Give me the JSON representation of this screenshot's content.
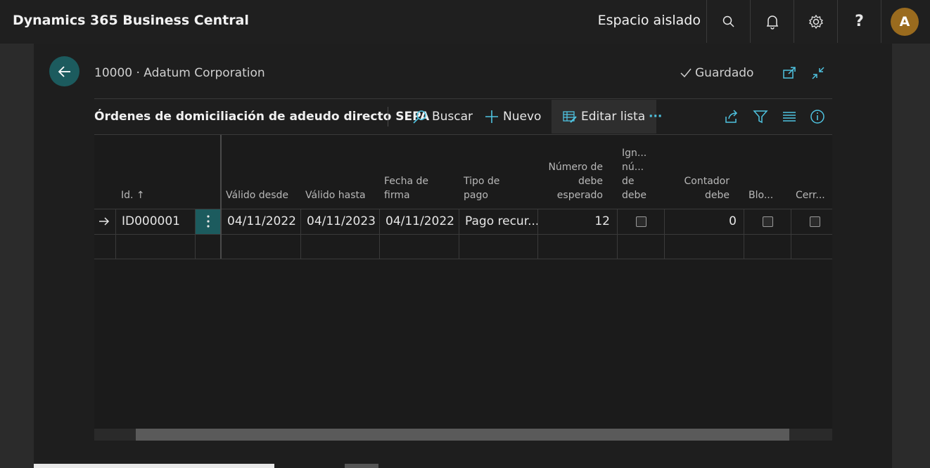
{
  "app": {
    "title": "Dynamics 365 Business Central",
    "environment": "Espacio aislado"
  },
  "topbar": {
    "icons": [
      "search-icon",
      "bell-icon",
      "gear-icon",
      "help-icon"
    ],
    "help_label": "?",
    "avatar_initial": "A"
  },
  "page": {
    "breadcrumb": "10000 · Adatum Corporation",
    "saved_label": "Guardado",
    "title": "Órdenes de domiciliación de adeudo directo SEPA"
  },
  "actions": {
    "search": "Buscar",
    "new": "Nuevo",
    "edit_list": "Editar lista",
    "more": "···"
  },
  "columns": {
    "id": "Id.",
    "valid_from": "Válido desde",
    "valid_to": "Válido hasta",
    "signature_date_1": "Fecha de",
    "signature_date_2": "firma",
    "payment_type_1": "Tipo de",
    "payment_type_2": "pago",
    "expected_1": "Número de",
    "expected_2": "debe",
    "expected_3": "esperado",
    "ignore_1": "Ign...",
    "ignore_2": "nú...",
    "ignore_3": "de",
    "ignore_4": "debe",
    "counter_1": "Contador",
    "counter_2": "debe",
    "blocked": "Blo...",
    "closed": "Cerr..."
  },
  "rows": [
    {
      "id": "ID000001",
      "valid_from": "04/11/2022",
      "valid_to": "04/11/2023",
      "signature_date": "04/11/2022",
      "payment_type": "Pago recur...",
      "expected": "12",
      "ignore": false,
      "counter": "0",
      "blocked": false,
      "closed": false
    }
  ],
  "colors": {
    "accent": "#1c5b5e",
    "avatar": "#9a6b1e",
    "icon": "#4fc3e0"
  }
}
